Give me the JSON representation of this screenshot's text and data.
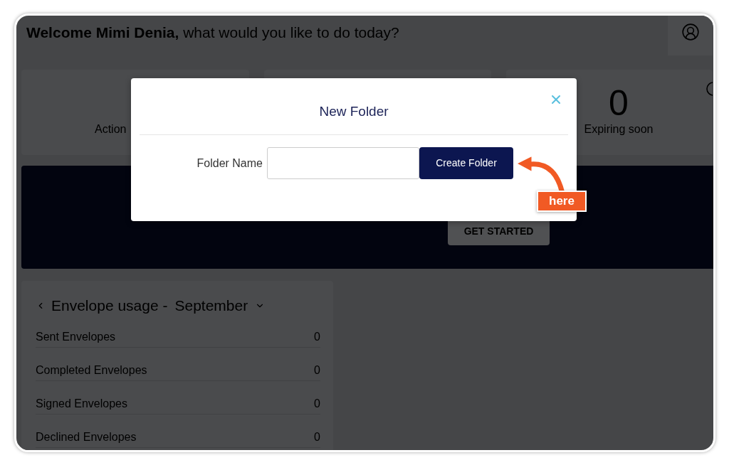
{
  "header": {
    "greeting": "**Welcome Mimi Denia,** what would you like to do today?"
  },
  "stats": [
    {
      "kind": "covered",
      "label": "Action"
    },
    {
      "kind": "plain",
      "value": "0",
      "label": "Expiring soon"
    }
  ],
  "banner": {
    "button": "GET STARTED"
  },
  "usage": {
    "title": "Envelope usage -",
    "month": "September",
    "rows": [
      {
        "label": "Sent Envelopes",
        "value": "0"
      },
      {
        "label": "Completed Envelopes",
        "value": "0"
      },
      {
        "label": "Signed Envelopes",
        "value": "0"
      },
      {
        "label": "Declined Envelopes",
        "value": "0"
      }
    ]
  },
  "dialog": {
    "title": "New Folder",
    "field_label": "Folder Name",
    "button": "Create Folder"
  },
  "annotation": {
    "label": "here"
  }
}
